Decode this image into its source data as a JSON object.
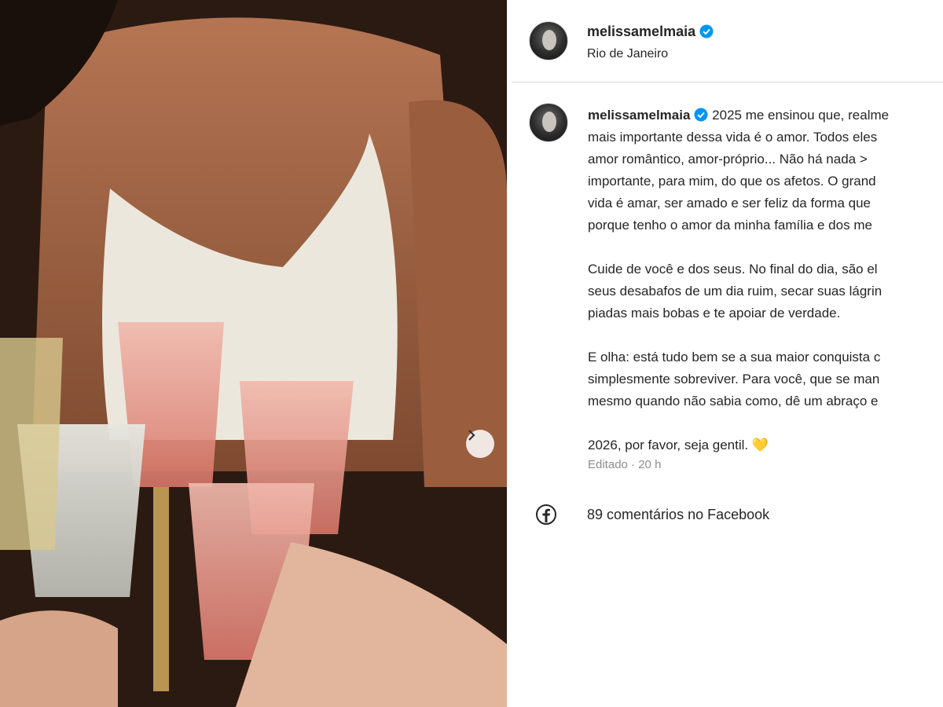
{
  "post": {
    "username": "melissamelmaia",
    "location": "Rio de Janeiro",
    "caption_lines": [
      [
        "2025 me ensinou que, realme",
        "mais importante dessa vida é o amor. Todos eles",
        "amor romântico, amor-próprio... Não há nada >",
        "importante, para mim, do que os afetos. O grand",
        "vida é amar, ser amado e ser feliz da forma que",
        "porque tenho o amor da minha família e dos me"
      ],
      [
        "Cuide de você e dos seus. No final do dia, são el",
        "seus desabafos de um dia ruim, secar suas lágrin",
        "piadas mais bobas e te apoiar de verdade."
      ],
      [
        "E olha: está tudo bem se a sua maior conquista c",
        "simplesmente sobreviver. Para você, que se man",
        "mesmo quando não sabia como, dê um abraço e"
      ],
      [
        "2026, por favor, seja gentil. 💛"
      ]
    ],
    "edited_label": "Editado",
    "time_label": "20 h",
    "comments_label": "89 comentários no Facebook"
  },
  "colors": {
    "verified": "#0095f6",
    "text": "#262626",
    "muted": "#8e8e8e"
  },
  "icons": {
    "next": "chevron-right-icon",
    "verified": "verified-badge-icon",
    "facebook": "facebook-icon"
  }
}
